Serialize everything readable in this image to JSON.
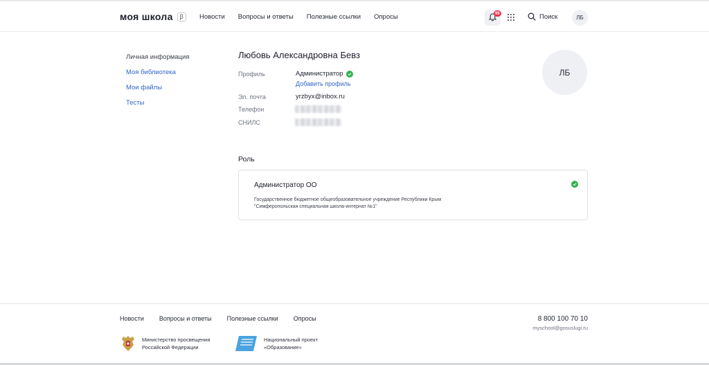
{
  "header": {
    "logo": "моя школа",
    "beta": "β",
    "nav": [
      "Новости",
      "Вопросы и ответы",
      "Полезные ссылки",
      "Опросы"
    ],
    "notifications_badge": "99",
    "search_label": "Поиск",
    "avatar_initials": "ЛБ"
  },
  "sidebar": {
    "items": [
      "Личная информация",
      "Моя библиотека",
      "Мои файлы",
      "Тесты"
    ]
  },
  "profile": {
    "full_name": "Любовь Александровна Бевз",
    "avatar_initials": "ЛБ",
    "profile_label": "Профиль",
    "profile_value": "Администратор",
    "add_profile": "Добавить профиль",
    "email_label": "Эл. почта",
    "email_value": "yrzbyx@inbox.ru",
    "phone_label": "Телефон",
    "snils_label": "СНИЛС"
  },
  "role": {
    "title": "Роль",
    "card_title": "Администратор ОО",
    "org_line1": "Государственное бюджетное общеобразовательное учреждение Республики Крым",
    "org_line2": "\"Симферопольская специальная школа-интернат №1\""
  },
  "footer": {
    "nav": [
      "Новости",
      "Вопросы и ответы",
      "Полезные ссылки",
      "Опросы"
    ],
    "phone": "8 800 100 70 10",
    "email": "myschool@gosuslugi.ru",
    "partner1_line1": "Министерство просвещения",
    "partner1_line2": "Российской Федерации",
    "partner2_line1": "Национальный проект",
    "partner2_line2": "«Образование»"
  },
  "colors": {
    "link": "#2f66c7",
    "success": "#2fb24c",
    "badge": "#e8334a"
  }
}
